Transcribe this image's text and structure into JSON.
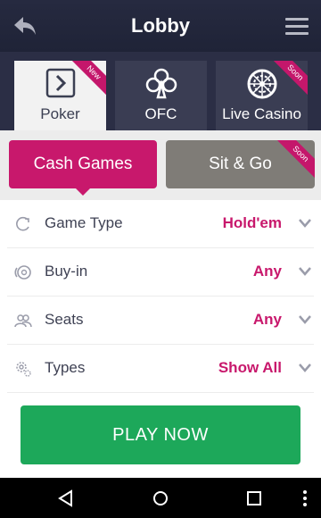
{
  "header": {
    "title": "Lobby",
    "back_icon": "back-arrow-icon",
    "menu_icon": "hamburger-menu-icon"
  },
  "game_tabs": [
    {
      "label": "Poker",
      "icon": "play-square-icon",
      "badge": "New",
      "active": true
    },
    {
      "label": "OFC",
      "icon": "club-suit-icon",
      "badge": "",
      "active": false
    },
    {
      "label": "Live Casino",
      "icon": "roulette-wheel-icon",
      "badge": "Soon",
      "active": false
    }
  ],
  "modes": [
    {
      "label": "Cash Games",
      "active": true,
      "badge": ""
    },
    {
      "label": "Sit & Go",
      "active": false,
      "badge": "Soon"
    }
  ],
  "filters": [
    {
      "label": "Game Type",
      "value": "Hold'em",
      "icon": "refresh-cycle-icon"
    },
    {
      "label": "Buy-in",
      "value": "Any",
      "icon": "coin-stack-icon"
    },
    {
      "label": "Seats",
      "value": "Any",
      "icon": "people-icon"
    },
    {
      "label": "Types",
      "value": "Show All",
      "icon": "settings-gears-icon"
    }
  ],
  "play_button": {
    "label": "PLAY NOW"
  },
  "colors": {
    "accent": "#c8186c",
    "header_bg": "#262a40",
    "play_green": "#1da85a",
    "inactive_mode": "#7f7c77"
  },
  "system_nav": {
    "back_icon": "nav-back-triangle-icon",
    "home_icon": "nav-home-circle-icon",
    "recents_icon": "nav-recents-square-icon",
    "more_icon": "nav-more-dots-icon"
  }
}
